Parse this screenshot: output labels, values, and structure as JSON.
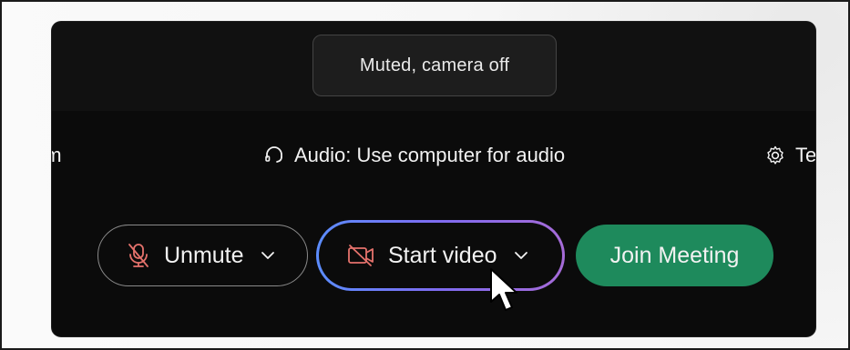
{
  "status": {
    "text": "Muted, camera off"
  },
  "options": {
    "left_partial": "em",
    "audio": {
      "label": "Audio: Use computer for audio",
      "icon": "headset-icon"
    },
    "right_partial": {
      "label": "Te",
      "icon": "gear-icon"
    }
  },
  "controls": {
    "unmute": {
      "label": "Unmute",
      "icon": "microphone-muted-icon"
    },
    "video": {
      "label": "Start video",
      "icon": "camera-off-icon"
    },
    "join": {
      "label": "Join Meeting"
    }
  },
  "colors": {
    "panel_bg": "#0b0b0b",
    "join_green": "#1e8a5c",
    "muted_red": "#e5726c",
    "focus_ring_start": "#5b8dff",
    "focus_ring_end": "#a66bd8"
  }
}
